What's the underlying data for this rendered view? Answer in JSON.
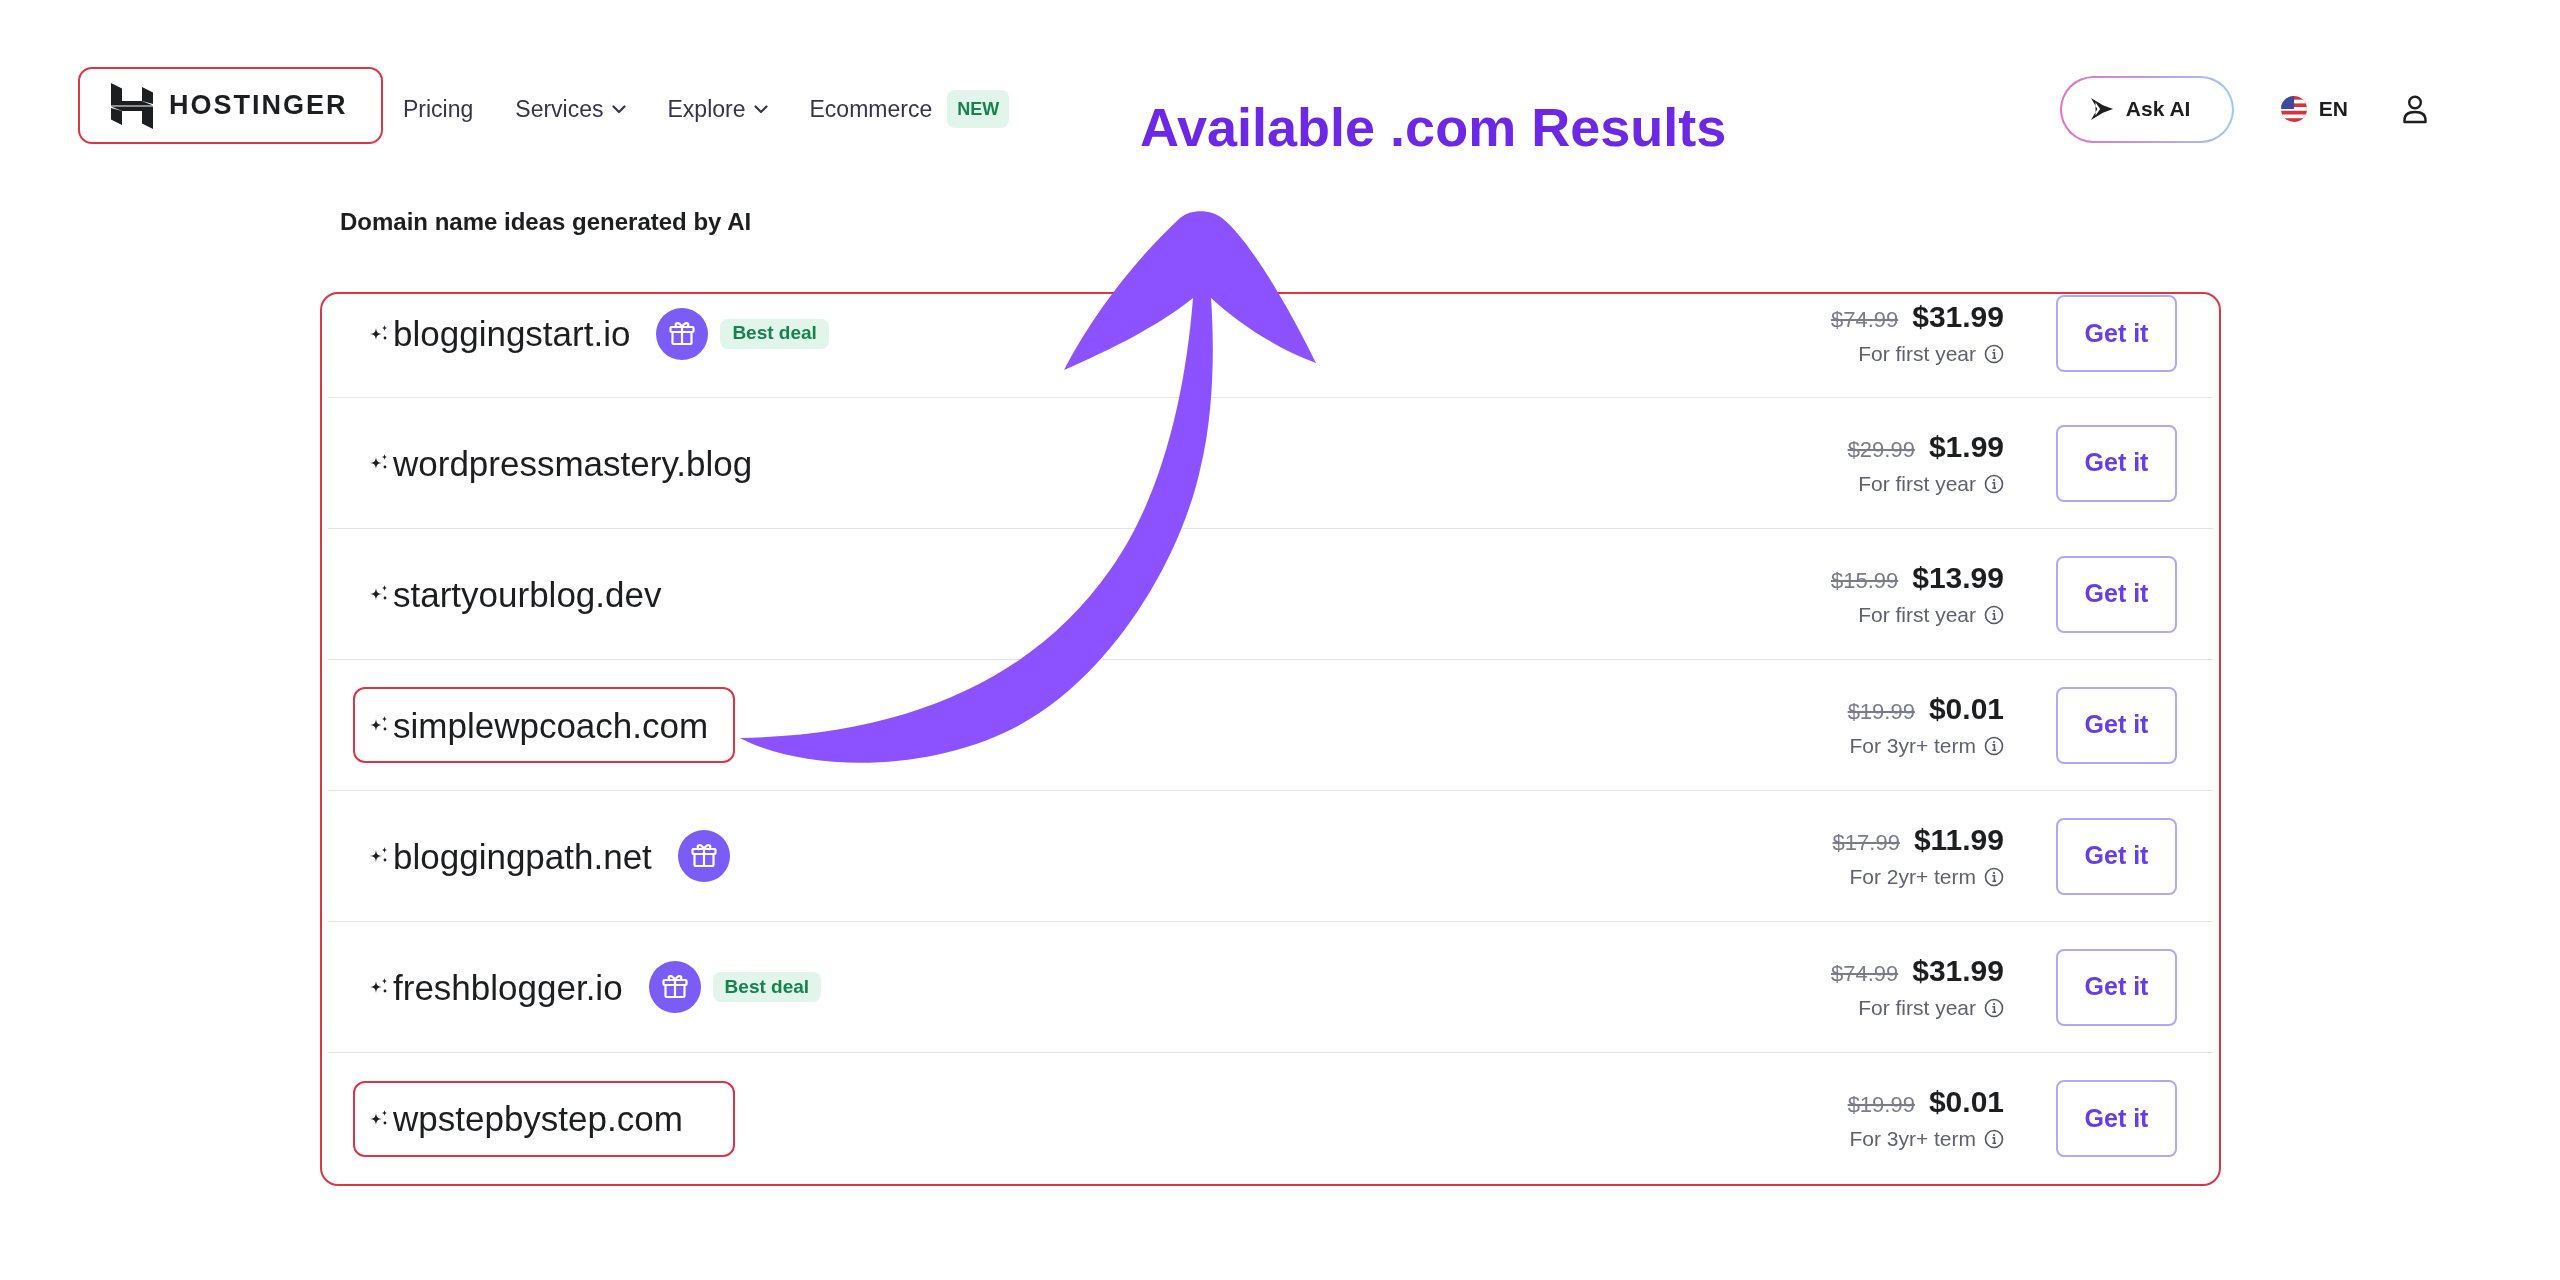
{
  "header": {
    "logo": {
      "text": "HOSTINGER",
      "highlighted": true
    },
    "nav": [
      {
        "label": "Pricing",
        "kind": "link"
      },
      {
        "label": "Services",
        "kind": "dropdown"
      },
      {
        "label": "Explore",
        "kind": "dropdown"
      },
      {
        "label": "Ecommerce",
        "kind": "link",
        "badge": "NEW"
      }
    ],
    "ask_ai": "Ask AI",
    "language": "EN"
  },
  "annotation": {
    "title": "Available .com Results"
  },
  "section_title": "Domain name ideas generated by AI",
  "results": {
    "highlighted": true,
    "domains": [
      {
        "name": "bloggingstart.io",
        "highlighted": false,
        "gift": true,
        "badge": "Best deal",
        "old_price": "$74.99",
        "price": "$31.99",
        "term": "For first year",
        "button": "Get it"
      },
      {
        "name": "wordpressmastery.blog",
        "highlighted": false,
        "gift": false,
        "old_price": "$29.99",
        "price": "$1.99",
        "term": "For first year",
        "button": "Get it"
      },
      {
        "name": "startyourblog.dev",
        "highlighted": false,
        "gift": false,
        "old_price": "$15.99",
        "price": "$13.99",
        "term": "For first year",
        "button": "Get it"
      },
      {
        "name": "simplewpcoach.com",
        "highlighted": true,
        "gift": false,
        "old_price": "$19.99",
        "price": "$0.01",
        "term": "For 3yr+ term",
        "button": "Get it"
      },
      {
        "name": "bloggingpath.net",
        "highlighted": false,
        "gift": true,
        "old_price": "$17.99",
        "price": "$11.99",
        "term": "For 2yr+ term",
        "button": "Get it"
      },
      {
        "name": "freshblogger.io",
        "highlighted": false,
        "gift": true,
        "badge": "Best deal",
        "old_price": "$74.99",
        "price": "$31.99",
        "term": "For first year",
        "button": "Get it"
      },
      {
        "name": "wpstepbystep.com",
        "highlighted": true,
        "gift": false,
        "old_price": "$19.99",
        "price": "$0.01",
        "term": "For 3yr+ term",
        "button": "Get it"
      }
    ]
  }
}
